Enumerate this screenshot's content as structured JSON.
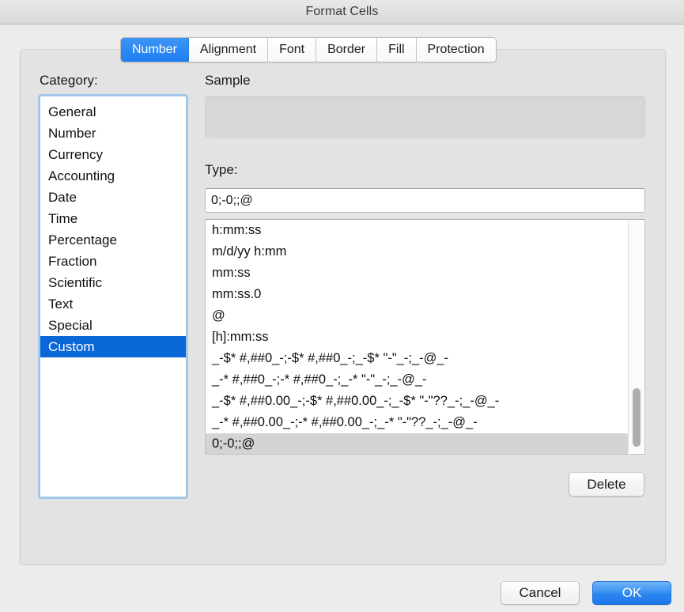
{
  "window": {
    "title": "Format Cells"
  },
  "tabs": [
    {
      "label": "Number",
      "active": true
    },
    {
      "label": "Alignment",
      "active": false
    },
    {
      "label": "Font",
      "active": false
    },
    {
      "label": "Border",
      "active": false
    },
    {
      "label": "Fill",
      "active": false
    },
    {
      "label": "Protection",
      "active": false
    }
  ],
  "category": {
    "label": "Category:",
    "items": [
      {
        "label": "General",
        "selected": false
      },
      {
        "label": "Number",
        "selected": false
      },
      {
        "label": "Currency",
        "selected": false
      },
      {
        "label": "Accounting",
        "selected": false
      },
      {
        "label": "Date",
        "selected": false
      },
      {
        "label": "Time",
        "selected": false
      },
      {
        "label": "Percentage",
        "selected": false
      },
      {
        "label": "Fraction",
        "selected": false
      },
      {
        "label": "Scientific",
        "selected": false
      },
      {
        "label": "Text",
        "selected": false
      },
      {
        "label": "Special",
        "selected": false
      },
      {
        "label": "Custom",
        "selected": true
      }
    ],
    "selected": "Custom"
  },
  "sample": {
    "label": "Sample",
    "value": ""
  },
  "type": {
    "label": "Type:",
    "value": "0;-0;;@",
    "placeholder": ""
  },
  "format_list": {
    "items": [
      {
        "label": "h:mm:ss",
        "selected": false
      },
      {
        "label": "m/d/yy h:mm",
        "selected": false
      },
      {
        "label": "mm:ss",
        "selected": false
      },
      {
        "label": "mm:ss.0",
        "selected": false
      },
      {
        "label": "@",
        "selected": false
      },
      {
        "label": "[h]:mm:ss",
        "selected": false
      },
      {
        "label": "_-$* #,##0_-;-$* #,##0_-;_-$* \"-\"_-;_-@_-",
        "selected": false
      },
      {
        "label": "_-* #,##0_-;-* #,##0_-;_-* \"-\"_-;_-@_-",
        "selected": false
      },
      {
        "label": "_-$* #,##0.00_-;-$* #,##0.00_-;_-$* \"-\"??_-;_-@_-",
        "selected": false
      },
      {
        "label": "_-* #,##0.00_-;-* #,##0.00_-;_-* \"-\"??_-;_-@_-",
        "selected": false
      },
      {
        "label": "0;-0;;@",
        "selected": true
      }
    ],
    "selected": "0;-0;;@"
  },
  "buttons": {
    "delete": "Delete",
    "cancel": "Cancel",
    "ok": "OK"
  },
  "colors": {
    "accent_blue": "#1f7ef0",
    "selection_blue": "#0a67d8",
    "selection_gray": "#d4d4d4",
    "window_bg": "#ececec",
    "panel_bg": "#e3e3e3"
  }
}
